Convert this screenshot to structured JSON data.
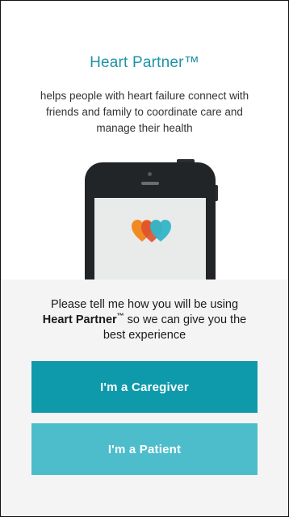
{
  "hero": {
    "title": "Heart Partner™",
    "tagline": "helps people with heart failure connect with friends and family to coordinate care and manage their health",
    "illustration_icon": "phone-with-hearts-icon"
  },
  "panel": {
    "prompt_before": "Please tell me how you will be using ",
    "prompt_brand": "Heart Partner",
    "prompt_tm": "™",
    "prompt_after": " so we can give you the best experience"
  },
  "buttons": {
    "caregiver_label": "I'm a Caregiver",
    "patient_label": "I'm a Patient"
  },
  "colors": {
    "accent": "#1d93a6",
    "caregiver_button": "#0e9aab",
    "patient_button": "#4dbdcb",
    "heart_orange": "#f08a24",
    "heart_red": "#e0512f",
    "heart_teal": "#33b5c8",
    "panel_background": "#f4f4f4"
  }
}
